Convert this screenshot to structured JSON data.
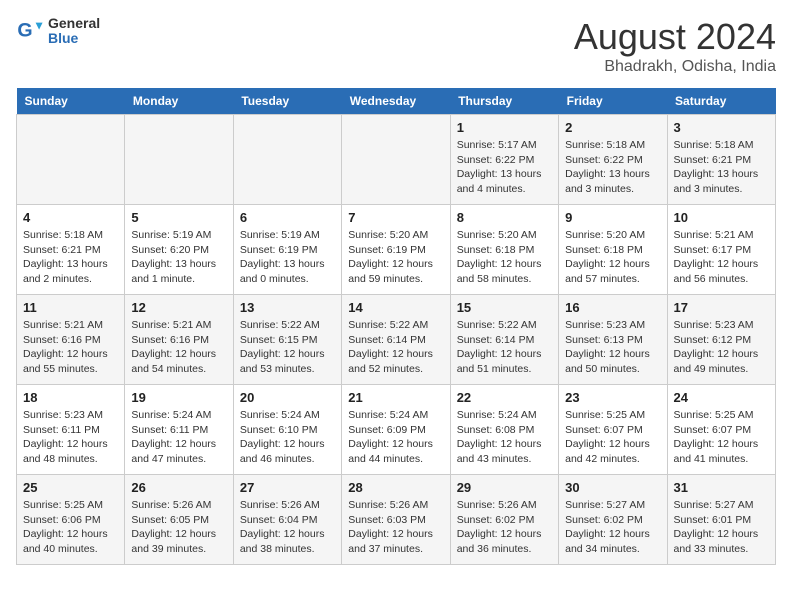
{
  "logo": {
    "general": "General",
    "blue": "Blue"
  },
  "title": {
    "month_year": "August 2024",
    "location": "Bhadrakh, Odisha, India"
  },
  "days_of_week": [
    "Sunday",
    "Monday",
    "Tuesday",
    "Wednesday",
    "Thursday",
    "Friday",
    "Saturday"
  ],
  "weeks": [
    [
      {
        "day": "",
        "info": ""
      },
      {
        "day": "",
        "info": ""
      },
      {
        "day": "",
        "info": ""
      },
      {
        "day": "",
        "info": ""
      },
      {
        "day": "1",
        "info": "Sunrise: 5:17 AM\nSunset: 6:22 PM\nDaylight: 13 hours\nand 4 minutes."
      },
      {
        "day": "2",
        "info": "Sunrise: 5:18 AM\nSunset: 6:22 PM\nDaylight: 13 hours\nand 3 minutes."
      },
      {
        "day": "3",
        "info": "Sunrise: 5:18 AM\nSunset: 6:21 PM\nDaylight: 13 hours\nand 3 minutes."
      }
    ],
    [
      {
        "day": "4",
        "info": "Sunrise: 5:18 AM\nSunset: 6:21 PM\nDaylight: 13 hours\nand 2 minutes."
      },
      {
        "day": "5",
        "info": "Sunrise: 5:19 AM\nSunset: 6:20 PM\nDaylight: 13 hours\nand 1 minute."
      },
      {
        "day": "6",
        "info": "Sunrise: 5:19 AM\nSunset: 6:19 PM\nDaylight: 13 hours\nand 0 minutes."
      },
      {
        "day": "7",
        "info": "Sunrise: 5:20 AM\nSunset: 6:19 PM\nDaylight: 12 hours\nand 59 minutes."
      },
      {
        "day": "8",
        "info": "Sunrise: 5:20 AM\nSunset: 6:18 PM\nDaylight: 12 hours\nand 58 minutes."
      },
      {
        "day": "9",
        "info": "Sunrise: 5:20 AM\nSunset: 6:18 PM\nDaylight: 12 hours\nand 57 minutes."
      },
      {
        "day": "10",
        "info": "Sunrise: 5:21 AM\nSunset: 6:17 PM\nDaylight: 12 hours\nand 56 minutes."
      }
    ],
    [
      {
        "day": "11",
        "info": "Sunrise: 5:21 AM\nSunset: 6:16 PM\nDaylight: 12 hours\nand 55 minutes."
      },
      {
        "day": "12",
        "info": "Sunrise: 5:21 AM\nSunset: 6:16 PM\nDaylight: 12 hours\nand 54 minutes."
      },
      {
        "day": "13",
        "info": "Sunrise: 5:22 AM\nSunset: 6:15 PM\nDaylight: 12 hours\nand 53 minutes."
      },
      {
        "day": "14",
        "info": "Sunrise: 5:22 AM\nSunset: 6:14 PM\nDaylight: 12 hours\nand 52 minutes."
      },
      {
        "day": "15",
        "info": "Sunrise: 5:22 AM\nSunset: 6:14 PM\nDaylight: 12 hours\nand 51 minutes."
      },
      {
        "day": "16",
        "info": "Sunrise: 5:23 AM\nSunset: 6:13 PM\nDaylight: 12 hours\nand 50 minutes."
      },
      {
        "day": "17",
        "info": "Sunrise: 5:23 AM\nSunset: 6:12 PM\nDaylight: 12 hours\nand 49 minutes."
      }
    ],
    [
      {
        "day": "18",
        "info": "Sunrise: 5:23 AM\nSunset: 6:11 PM\nDaylight: 12 hours\nand 48 minutes."
      },
      {
        "day": "19",
        "info": "Sunrise: 5:24 AM\nSunset: 6:11 PM\nDaylight: 12 hours\nand 47 minutes."
      },
      {
        "day": "20",
        "info": "Sunrise: 5:24 AM\nSunset: 6:10 PM\nDaylight: 12 hours\nand 46 minutes."
      },
      {
        "day": "21",
        "info": "Sunrise: 5:24 AM\nSunset: 6:09 PM\nDaylight: 12 hours\nand 44 minutes."
      },
      {
        "day": "22",
        "info": "Sunrise: 5:24 AM\nSunset: 6:08 PM\nDaylight: 12 hours\nand 43 minutes."
      },
      {
        "day": "23",
        "info": "Sunrise: 5:25 AM\nSunset: 6:07 PM\nDaylight: 12 hours\nand 42 minutes."
      },
      {
        "day": "24",
        "info": "Sunrise: 5:25 AM\nSunset: 6:07 PM\nDaylight: 12 hours\nand 41 minutes."
      }
    ],
    [
      {
        "day": "25",
        "info": "Sunrise: 5:25 AM\nSunset: 6:06 PM\nDaylight: 12 hours\nand 40 minutes."
      },
      {
        "day": "26",
        "info": "Sunrise: 5:26 AM\nSunset: 6:05 PM\nDaylight: 12 hours\nand 39 minutes."
      },
      {
        "day": "27",
        "info": "Sunrise: 5:26 AM\nSunset: 6:04 PM\nDaylight: 12 hours\nand 38 minutes."
      },
      {
        "day": "28",
        "info": "Sunrise: 5:26 AM\nSunset: 6:03 PM\nDaylight: 12 hours\nand 37 minutes."
      },
      {
        "day": "29",
        "info": "Sunrise: 5:26 AM\nSunset: 6:02 PM\nDaylight: 12 hours\nand 36 minutes."
      },
      {
        "day": "30",
        "info": "Sunrise: 5:27 AM\nSunset: 6:02 PM\nDaylight: 12 hours\nand 34 minutes."
      },
      {
        "day": "31",
        "info": "Sunrise: 5:27 AM\nSunset: 6:01 PM\nDaylight: 12 hours\nand 33 minutes."
      }
    ]
  ]
}
